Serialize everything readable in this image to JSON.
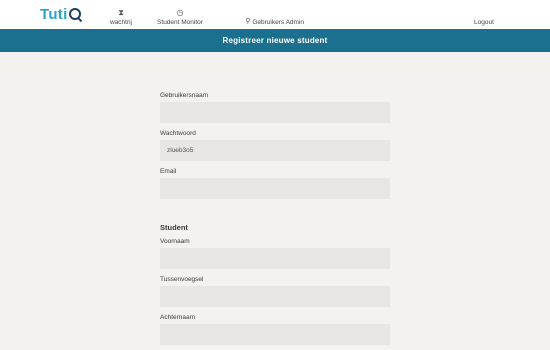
{
  "brand": {
    "logo_text_a": "Tuti",
    "logo_text_b": "Q"
  },
  "nav": {
    "wachtrij": {
      "label": "wachtrij",
      "icon": "hourglass-icon"
    },
    "monitor": {
      "label": "Student Monitor",
      "icon": "clock-icon"
    },
    "admin": {
      "label": "Gebruikers Admin",
      "icon": "search-icon"
    },
    "logout": {
      "label": "Logout"
    }
  },
  "page": {
    "title": "Registreer nieuwe student"
  },
  "form": {
    "username": {
      "label": "Gebruikersnaam",
      "value": ""
    },
    "password": {
      "label": "Wachtwoord",
      "value": "zlueb3o5"
    },
    "email": {
      "label": "Email",
      "value": ""
    },
    "student_section": "Student",
    "firstname": {
      "label": "Voornaam",
      "value": ""
    },
    "infix": {
      "label": "Tussenvoegsel",
      "value": ""
    },
    "lastname": {
      "label": "Achternaam",
      "value": ""
    }
  },
  "colors": {
    "brand_cyan": "#2aa3c9",
    "brand_navy": "#1d3f5e",
    "titlebar": "#1b6f8f",
    "background": "#f4f2ef",
    "field_bg": "#e8e6e3"
  }
}
